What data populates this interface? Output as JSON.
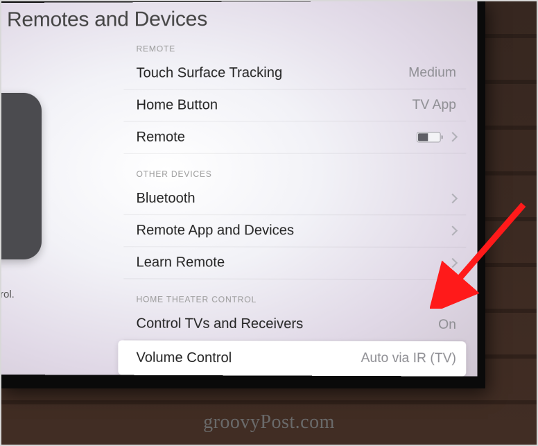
{
  "page": {
    "title": "Remotes and Devices",
    "side_caption": "rol."
  },
  "sections": {
    "remote": {
      "header": "REMOTE",
      "touch_surface": {
        "label": "Touch Surface Tracking",
        "value": "Medium"
      },
      "home_button": {
        "label": "Home Button",
        "value": "TV App"
      },
      "remote": {
        "label": "Remote",
        "battery_pct": 45
      }
    },
    "other": {
      "header": "OTHER DEVICES",
      "bluetooth": {
        "label": "Bluetooth"
      },
      "remote_app": {
        "label": "Remote App and Devices"
      },
      "learn": {
        "label": "Learn Remote"
      }
    },
    "theater": {
      "header": "HOME THEATER CONTROL",
      "control_tvs": {
        "label": "Control TVs and Receivers",
        "value": "On"
      },
      "volume": {
        "label": "Volume Control",
        "value": "Auto via IR (TV)"
      }
    }
  },
  "watermark": "groovyPost.com",
  "annotation": {
    "color": "#ff1a1a"
  }
}
